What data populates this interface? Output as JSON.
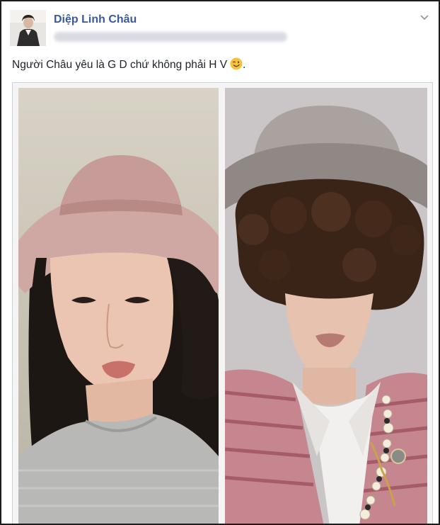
{
  "post": {
    "author_name": "Diệp Linh Châu",
    "status_text": "Người Châu yêu là G D chứ không phải H V",
    "status_end": ".",
    "emoji_icon": "wink-emoji-icon",
    "menu_icon": "chevron-down-icon"
  },
  "colors": {
    "author_link": "#3b5998",
    "text": "#1d2129",
    "frame": "#1d1d1d"
  }
}
